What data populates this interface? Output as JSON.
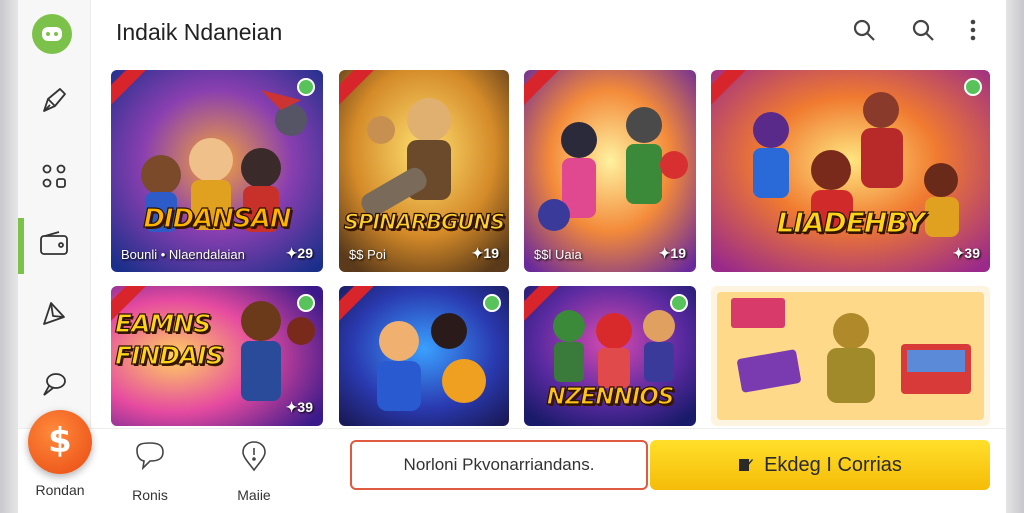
{
  "header": {
    "title": "Indaik Ndaneian"
  },
  "icons": {
    "logo": "gamepad-logo-icon",
    "search": "search-icon",
    "search_alt": "search-icon",
    "more": "more-vertical-icon",
    "sidebar": [
      "pen-icon",
      "grid-icon",
      "wallet-icon",
      "send-icon",
      "chat-icon"
    ]
  },
  "cards": [
    {
      "title": "DIDANSAN",
      "subtitle": "Bounli • Nlaendalaian",
      "price": "29"
    },
    {
      "title": "SPINARBGUNS",
      "subtitle": "$$ Poi",
      "price": "19"
    },
    {
      "title": "",
      "subtitle": "$$l Uaia",
      "price": "19"
    },
    {
      "title": "LIADEHBY",
      "subtitle": "",
      "price": "39"
    },
    {
      "title": "EAMNS FINDAIS",
      "subtitle": "",
      "price": "39"
    },
    {
      "title": "",
      "subtitle": "",
      "price": ""
    },
    {
      "title": "NZENNIOS",
      "subtitle": "",
      "price": ""
    },
    {
      "title": "",
      "subtitle": "",
      "price": ""
    }
  ],
  "bottom_nav": {
    "items": [
      {
        "label": "Rondan",
        "icon": "dollar-icon"
      },
      {
        "label": "Ronis",
        "icon": "speech-bubble-icon"
      },
      {
        "label": "Maiie",
        "icon": "pin-icon"
      }
    ]
  },
  "search": {
    "value": "Norloni Pkvonarriandans."
  },
  "cta": {
    "label": "Ekdeg I Corrias"
  },
  "colors": {
    "accent": "#7cc24a",
    "cta": "#f8c80e",
    "fab": "#ee5a1e",
    "ribbon": "#d8242b"
  }
}
